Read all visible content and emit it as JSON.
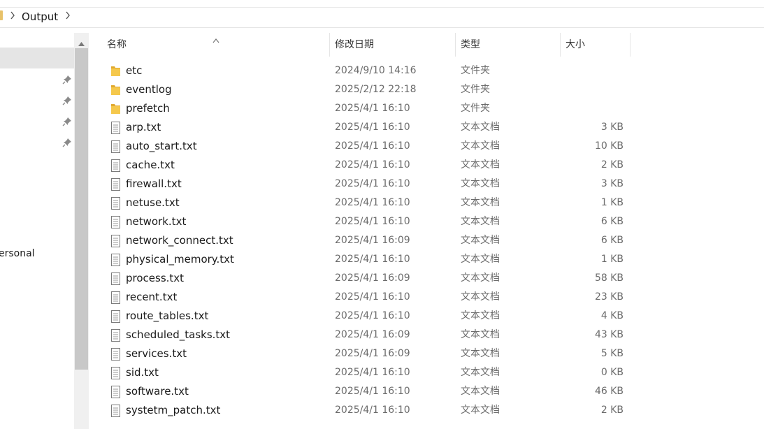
{
  "breadcrumb": {
    "current": "Output"
  },
  "nav": {
    "partial_label": "ersonal"
  },
  "columns": {
    "name": "名称",
    "date": "修改日期",
    "type": "类型",
    "size": "大小"
  },
  "colors": {
    "folder": "#f2c14e",
    "selection": "#e5e5e5",
    "scrollbar_thumb": "#c8c8c8"
  },
  "files": [
    {
      "name": "etc",
      "date": "2024/9/10 14:16",
      "type": "文件夹",
      "size": "",
      "icon": "folder-icon"
    },
    {
      "name": "eventlog",
      "date": "2025/2/12 22:18",
      "type": "文件夹",
      "size": "",
      "icon": "folder-icon"
    },
    {
      "name": "prefetch",
      "date": "2025/4/1 16:10",
      "type": "文件夹",
      "size": "",
      "icon": "folder-icon"
    },
    {
      "name": "arp.txt",
      "date": "2025/4/1 16:10",
      "type": "文本文档",
      "size": "3 KB",
      "icon": "text-file-icon"
    },
    {
      "name": "auto_start.txt",
      "date": "2025/4/1 16:10",
      "type": "文本文档",
      "size": "10 KB",
      "icon": "text-file-icon"
    },
    {
      "name": "cache.txt",
      "date": "2025/4/1 16:10",
      "type": "文本文档",
      "size": "2 KB",
      "icon": "text-file-icon"
    },
    {
      "name": "firewall.txt",
      "date": "2025/4/1 16:10",
      "type": "文本文档",
      "size": "3 KB",
      "icon": "text-file-icon"
    },
    {
      "name": "netuse.txt",
      "date": "2025/4/1 16:10",
      "type": "文本文档",
      "size": "1 KB",
      "icon": "text-file-icon"
    },
    {
      "name": "network.txt",
      "date": "2025/4/1 16:10",
      "type": "文本文档",
      "size": "6 KB",
      "icon": "text-file-icon"
    },
    {
      "name": "network_connect.txt",
      "date": "2025/4/1 16:09",
      "type": "文本文档",
      "size": "6 KB",
      "icon": "text-file-icon"
    },
    {
      "name": "physical_memory.txt",
      "date": "2025/4/1 16:10",
      "type": "文本文档",
      "size": "1 KB",
      "icon": "text-file-icon"
    },
    {
      "name": "process.txt",
      "date": "2025/4/1 16:09",
      "type": "文本文档",
      "size": "58 KB",
      "icon": "text-file-icon"
    },
    {
      "name": "recent.txt",
      "date": "2025/4/1 16:10",
      "type": "文本文档",
      "size": "23 KB",
      "icon": "text-file-icon"
    },
    {
      "name": "route_tables.txt",
      "date": "2025/4/1 16:10",
      "type": "文本文档",
      "size": "4 KB",
      "icon": "text-file-icon"
    },
    {
      "name": "scheduled_tasks.txt",
      "date": "2025/4/1 16:09",
      "type": "文本文档",
      "size": "43 KB",
      "icon": "text-file-icon"
    },
    {
      "name": "services.txt",
      "date": "2025/4/1 16:09",
      "type": "文本文档",
      "size": "5 KB",
      "icon": "text-file-icon"
    },
    {
      "name": "sid.txt",
      "date": "2025/4/1 16:10",
      "type": "文本文档",
      "size": "0 KB",
      "icon": "text-file-icon"
    },
    {
      "name": "software.txt",
      "date": "2025/4/1 16:10",
      "type": "文本文档",
      "size": "46 KB",
      "icon": "text-file-icon"
    },
    {
      "name": "systetm_patch.txt",
      "date": "2025/4/1 16:10",
      "type": "文本文档",
      "size": "2 KB",
      "icon": "text-file-icon"
    }
  ]
}
